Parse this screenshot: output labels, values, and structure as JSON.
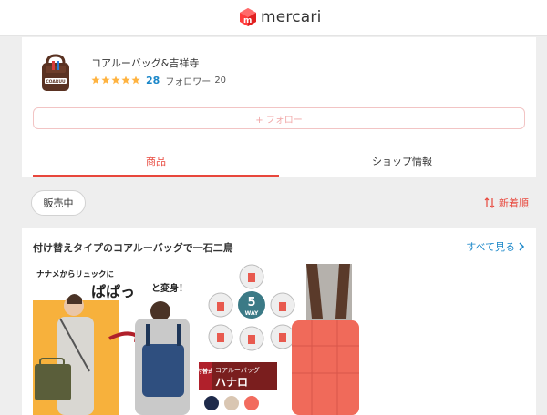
{
  "header": {
    "logo_text": "mercari",
    "logo_icon": "mercari-box-icon"
  },
  "shop": {
    "name": "コアルーバッグ&吉祥寺",
    "avatar_icon": "backpack-logo-icon",
    "avatar_text": "COARUU",
    "rating_stars": 5,
    "rating_count": "28",
    "follower_label": "フォロワー",
    "follower_count": "20",
    "follow_label": "+ フォロー"
  },
  "tabs": [
    {
      "label": "商品",
      "active": true
    },
    {
      "label": "ショップ情報",
      "active": false
    }
  ],
  "filter": {
    "status_chip": "販売中",
    "sort_label": "新着順"
  },
  "feature": {
    "title": "付け替えタイプのコアルーバッグで一石二鳥",
    "see_all": "すべて見る",
    "banner": {
      "text_top": "ナナメからリュックに",
      "text_big": "ぱぱっ",
      "text_after": "と変身！",
      "way_num": "5",
      "way_label": "WAY",
      "tag_small": "付替式",
      "product_small": "コアルーバッグ",
      "product_big": "ハナロ"
    }
  },
  "colors": {
    "accent": "#e8473c",
    "link": "#1a87c9",
    "star": "#ffb340"
  }
}
